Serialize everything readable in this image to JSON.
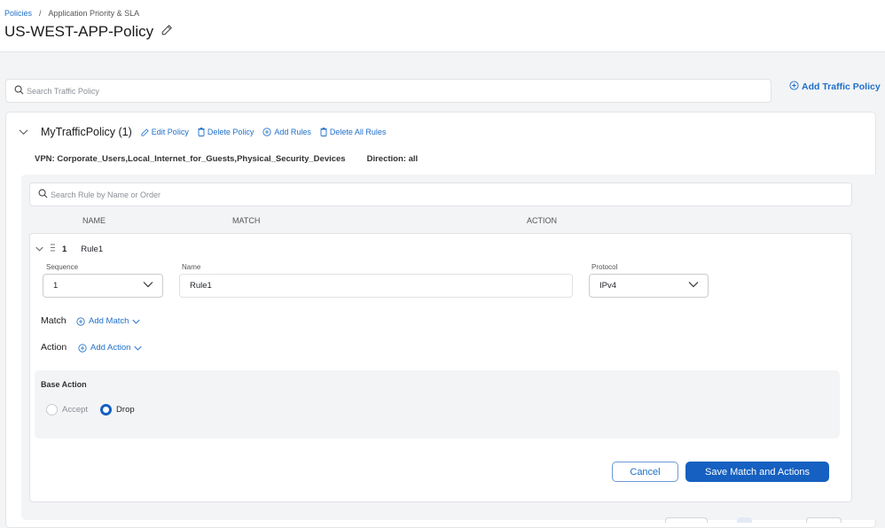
{
  "breadcrumb": {
    "root": "Policies",
    "separator": "/",
    "current": "Application Priority & SLA"
  },
  "page": {
    "title": "US-WEST-APP-Policy",
    "edit_icon": "pencil-icon"
  },
  "policy_search": {
    "placeholder": "Search Traffic Policy",
    "value": ""
  },
  "add_traffic_policy": "Add Traffic Policy",
  "policy": {
    "name": "MyTrafficPolicy (1)",
    "actions": {
      "edit": "Edit Policy",
      "delete": "Delete Policy",
      "add_rules": "Add Rules",
      "delete_all": "Delete All Rules"
    },
    "vpn": "VPN: Corporate_Users,Local_Internet_for_Guests,Physical_Security_Devices",
    "direction": "Direction: all"
  },
  "rule_search": {
    "placeholder": "Search Rule by Name or Order",
    "value": ""
  },
  "columns": {
    "name": "NAME",
    "match": "MATCH",
    "action": "ACTION"
  },
  "rule": {
    "order": "1",
    "name": "Rule1",
    "sequence_label": "Sequence",
    "sequence_value": "1",
    "name_label": "Name",
    "name_value": "Rule1",
    "protocol_label": "Protocol",
    "protocol_value": "IPv4",
    "match_label": "Match",
    "add_match": "Add Match",
    "action_label": "Action",
    "add_action": "Add Action",
    "base_action_title": "Base Action",
    "base_action_options": [
      {
        "label": "Accept",
        "selected": false
      },
      {
        "label": "Drop",
        "selected": true
      }
    ],
    "cancel": "Cancel",
    "save": "Save Match and Actions"
  },
  "colors": {
    "accent": "#1f6fc9",
    "primary_button": "#1560c0",
    "background": "#f3f4f6"
  }
}
